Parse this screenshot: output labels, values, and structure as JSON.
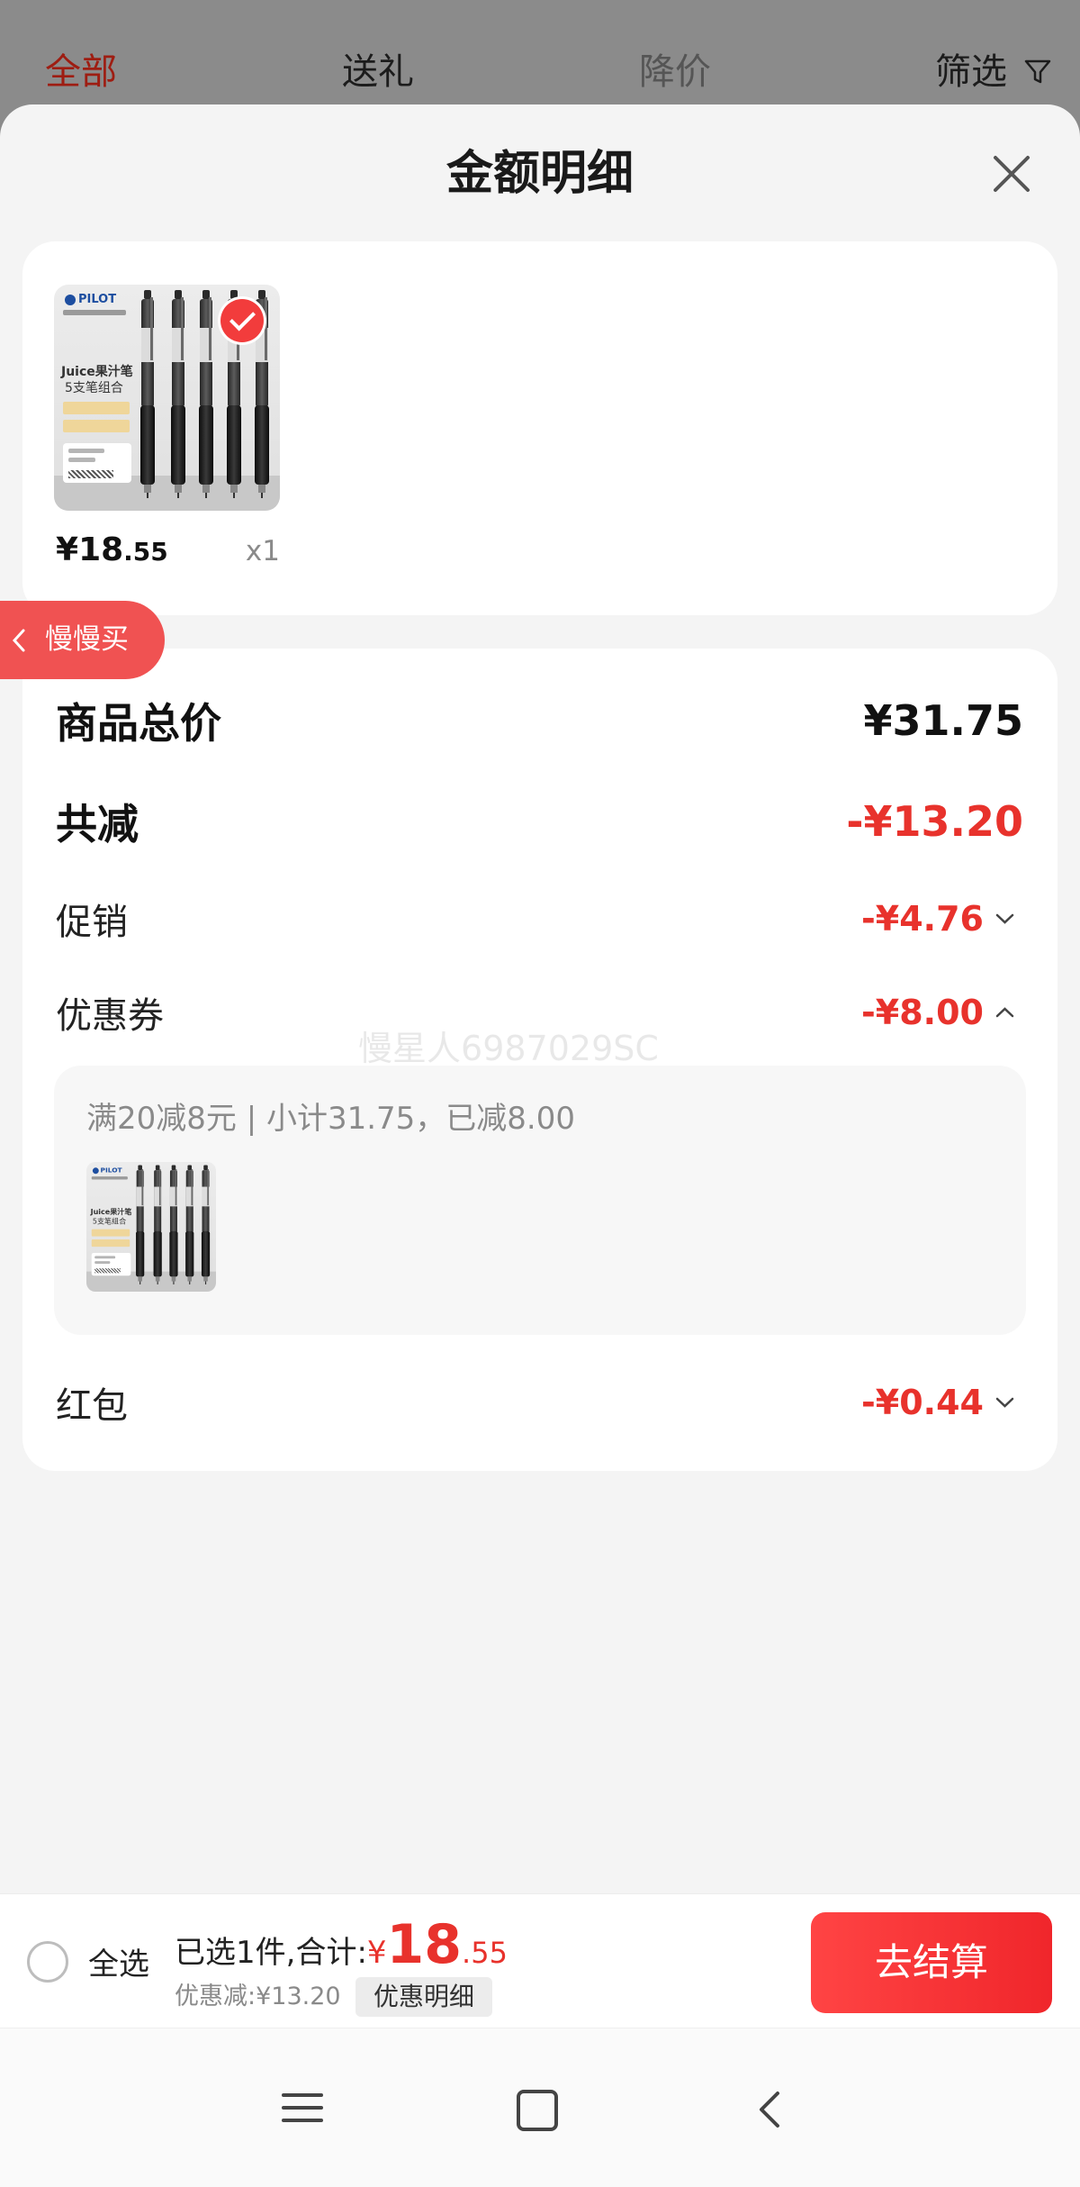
{
  "tabs": [
    {
      "label": "全部",
      "active": true
    },
    {
      "label": "送礼",
      "active": false
    },
    {
      "label": "降价",
      "active": false
    }
  ],
  "filter": {
    "label": "筛选",
    "icon": "filter-icon"
  },
  "sheet": {
    "title": "金额明细",
    "close_icon": "close-icon"
  },
  "product": {
    "selected": true,
    "price_symbol": "¥",
    "price_integer": "18",
    "price_decimal": ".55",
    "quantity": "x1",
    "image": {
      "brand": "PILOT",
      "line1": "Juice果汁笔",
      "line2": "5支笔组合",
      "pen_count": 5
    }
  },
  "float_button": {
    "label": "慢慢买",
    "icon": "chevron-left-icon"
  },
  "breakdown": {
    "goods_total": {
      "label": "商品总价",
      "value": "¥31.75"
    },
    "total_reduction": {
      "label": "共减",
      "value": "-¥13.20"
    },
    "promotion": {
      "label": "促销",
      "value": "-¥4.76",
      "expanded": false
    },
    "coupon": {
      "label": "优惠券",
      "value": "-¥8.00",
      "expanded": true,
      "detail": {
        "text": "满20减8元 | 小计31.75，已减8.00"
      }
    },
    "red_packet": {
      "label": "红包",
      "value": "-¥0.44",
      "expanded": false
    }
  },
  "watermark": "慢星人6987029SC",
  "bottom_bar": {
    "select_all": "全选",
    "select_all_checked": false,
    "selected_summary": "已选1件,合计:",
    "total_symbol": "¥",
    "total_integer": "18",
    "total_decimal": ".55",
    "discount": "优惠减:¥13.20",
    "detail_button": "优惠明细",
    "checkout_button": "去结算"
  },
  "nav_bar": {
    "icons": [
      "menu-icon",
      "home-square-icon",
      "back-icon"
    ]
  },
  "colors": {
    "accent": "#e8322c",
    "checkout_button": "#f5282f",
    "float_button": "#f05252",
    "sheet_background": "#f4f4f4",
    "active_tab": "#9e1d12"
  }
}
